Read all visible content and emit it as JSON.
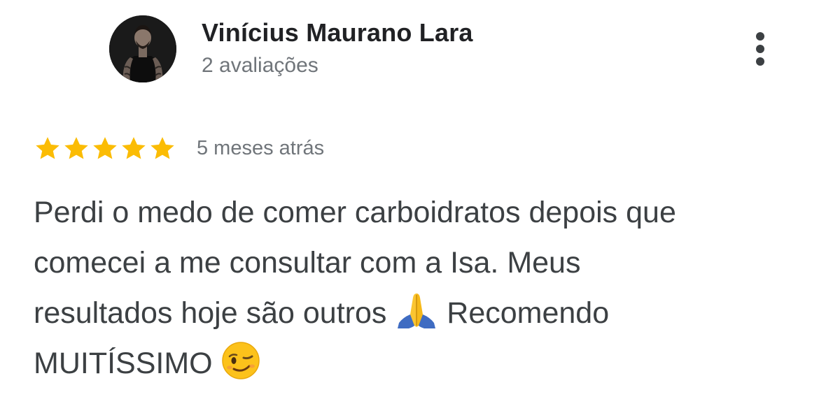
{
  "review": {
    "author": {
      "name": "Vinícius Maurano Lara",
      "meta": "2 avaliações",
      "avatar_icon": "profile-photo"
    },
    "menu_icon": "more-vert-icon",
    "rating": {
      "stars": 5,
      "max_stars": 5,
      "star_color": "#fbbc04"
    },
    "date": "5 meses atrás",
    "text_lines": [
      "Perdi o medo de comer carboidratos depois que",
      "comecei a me consultar com a Isa. Meus",
      "resultados hoje são outros",
      "Recomendo",
      "MUITÍSSIMO"
    ],
    "emojis": [
      "folded-hands-emoji",
      "winking-face-emoji"
    ]
  }
}
